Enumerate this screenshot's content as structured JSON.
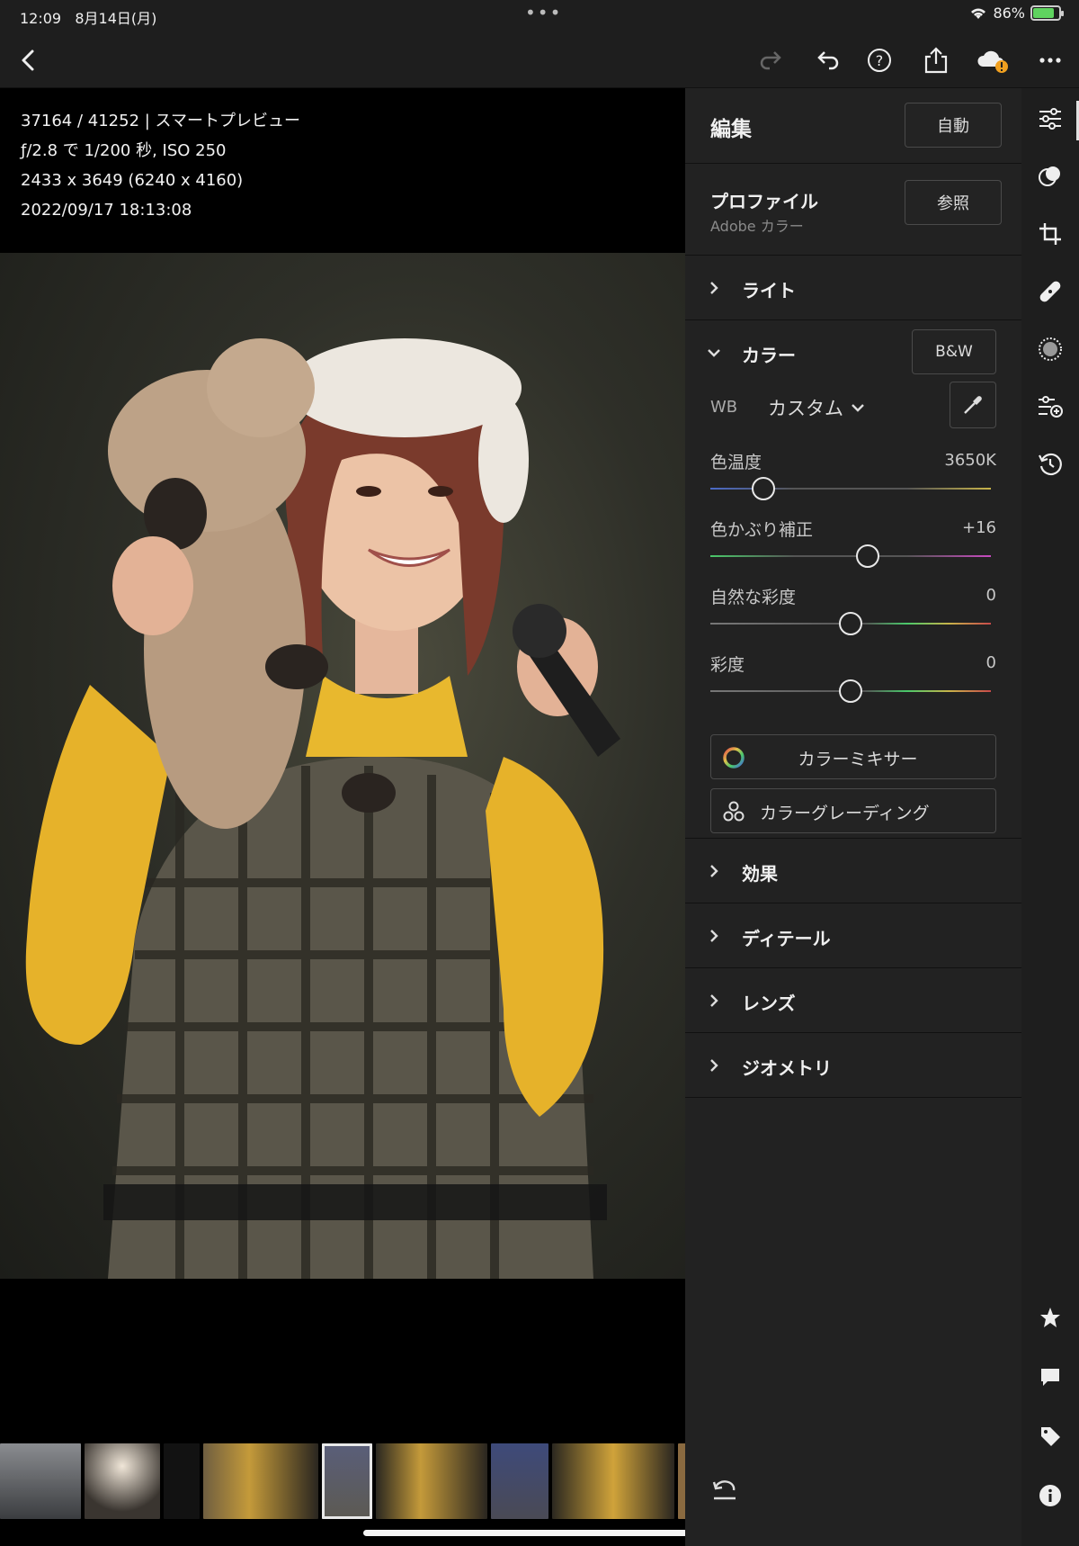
{
  "status_bar": {
    "time": "12:09",
    "date": "8月14日(月)",
    "battery": "86%"
  },
  "photo_info": {
    "line1": "37164 / 41252 | スマートプレビュー",
    "line2": "ƒ/2.8 で 1/200 秒, ISO 250",
    "line3": "2433 x 3649 (6240 x 4160)",
    "line4": "2022/09/17 18:13:08"
  },
  "toolbar": {
    "icons": [
      "back-icon",
      "redo-icon",
      "undo-icon",
      "help-icon",
      "share-icon",
      "cloud-warning-icon",
      "more-icon"
    ]
  },
  "panel": {
    "header": {
      "title": "編集",
      "auto_label": "自動"
    },
    "profile": {
      "title": "プロファイル",
      "subtitle": "Adobe カラー",
      "browse_label": "参照"
    },
    "light": {
      "title": "ライト"
    },
    "color": {
      "title": "カラー",
      "bw_label": "B&W",
      "wb_label": "WB",
      "wb_value": "カスタム",
      "sliders": [
        {
          "label": "色温度",
          "value": "3650K",
          "level": 0.19
        },
        {
          "label": "色かぶり補正",
          "value": "+16",
          "level": 0.56
        },
        {
          "label": "自然な彩度",
          "value": "0",
          "level": 0.5
        },
        {
          "label": "彩度",
          "value": "0",
          "level": 0.5
        }
      ],
      "mixer_label": "カラーミキサー",
      "grading_label": "カラーグレーディング"
    },
    "effects": {
      "title": "効果"
    },
    "detail": {
      "title": "ディテール"
    },
    "lens": {
      "title": "レンズ"
    },
    "geometry": {
      "title": "ジオメトリ"
    }
  },
  "rail": {
    "icons": [
      "edit-sliders-icon",
      "presets-icon",
      "crop-icon",
      "healing-icon",
      "masking-icon",
      "versions-icon",
      "history-icon",
      "star-icon",
      "comment-icon",
      "tag-icon",
      "info-icon"
    ]
  },
  "colors": {
    "panel_bg": "#222222",
    "rail_bg": "#1e1e1e",
    "accent_warning": "#f0a020"
  }
}
